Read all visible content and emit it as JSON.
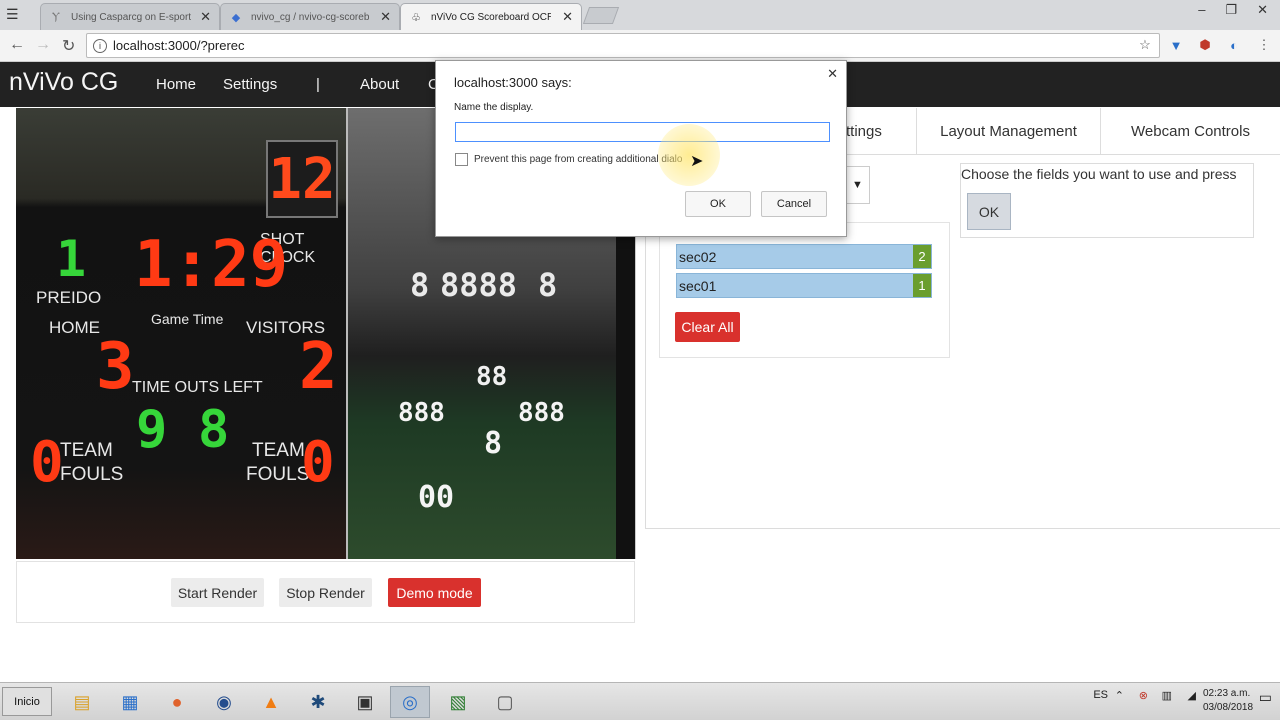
{
  "browser": {
    "tabs": [
      {
        "title": "Using Casparcg on E-sports"
      },
      {
        "title": "nvivo_cg / nvivo-cg-scoreb"
      },
      {
        "title": "nViVo CG Scoreboard OCR"
      }
    ],
    "url": "localhost:3000/?prerec"
  },
  "app": {
    "brand": "nViVo CG",
    "nav": {
      "home": "Home",
      "settings": "Settings",
      "separator": "|",
      "about": "About",
      "cut": "C"
    }
  },
  "preview": {
    "scoreboard": {
      "shot_clock_value": "12",
      "shot_clock_label": "SHOT CLOCK",
      "period": "1",
      "game_time": "1:29",
      "game_time_label": "Game Time",
      "home_name": "PREIDO",
      "home_label": "HOME",
      "visitors_label": "VISITORS",
      "home_score": "3",
      "visitors_score": "2",
      "timeouts_label": "TIME OUTS LEFT",
      "home_timeouts": "9",
      "visitors_timeouts": "8",
      "home_fouls": "0",
      "visitors_fouls": "0",
      "team_label": "TEAM",
      "fouls_label": "FOULS"
    },
    "controller_digits": [
      "8",
      "8888",
      "8",
      "88",
      "888",
      "888",
      "8",
      "00"
    ]
  },
  "controls": {
    "start_render": "Start Render",
    "stop_render": "Stop Render",
    "demo_mode": "Demo mode"
  },
  "right_panel": {
    "tabs": {
      "settings_partial": "ttings",
      "layout": "Layout Management",
      "webcam": "Webcam Controls"
    },
    "fields": [
      {
        "name": "sec02",
        "badge": "2"
      },
      {
        "name": "sec01",
        "badge": "1"
      }
    ],
    "clear_all": "Clear All",
    "choose_text": "Choose the fields you want to use and press",
    "ok": "OK"
  },
  "dialog": {
    "title": "localhost:3000 says:",
    "message": "Name the display.",
    "input_value": "",
    "checkbox_label": "Prevent this page from creating additional dialo",
    "ok": "OK",
    "cancel": "Cancel"
  },
  "taskbar": {
    "start": "Inicio",
    "lang": "ES",
    "time": "02:23 a.m.",
    "date": "03/08/2018"
  },
  "colors": {
    "navbar": "#222222",
    "field_item": "#a6cbe8",
    "field_badge": "#6a9e2e",
    "danger": "#d9312d"
  }
}
